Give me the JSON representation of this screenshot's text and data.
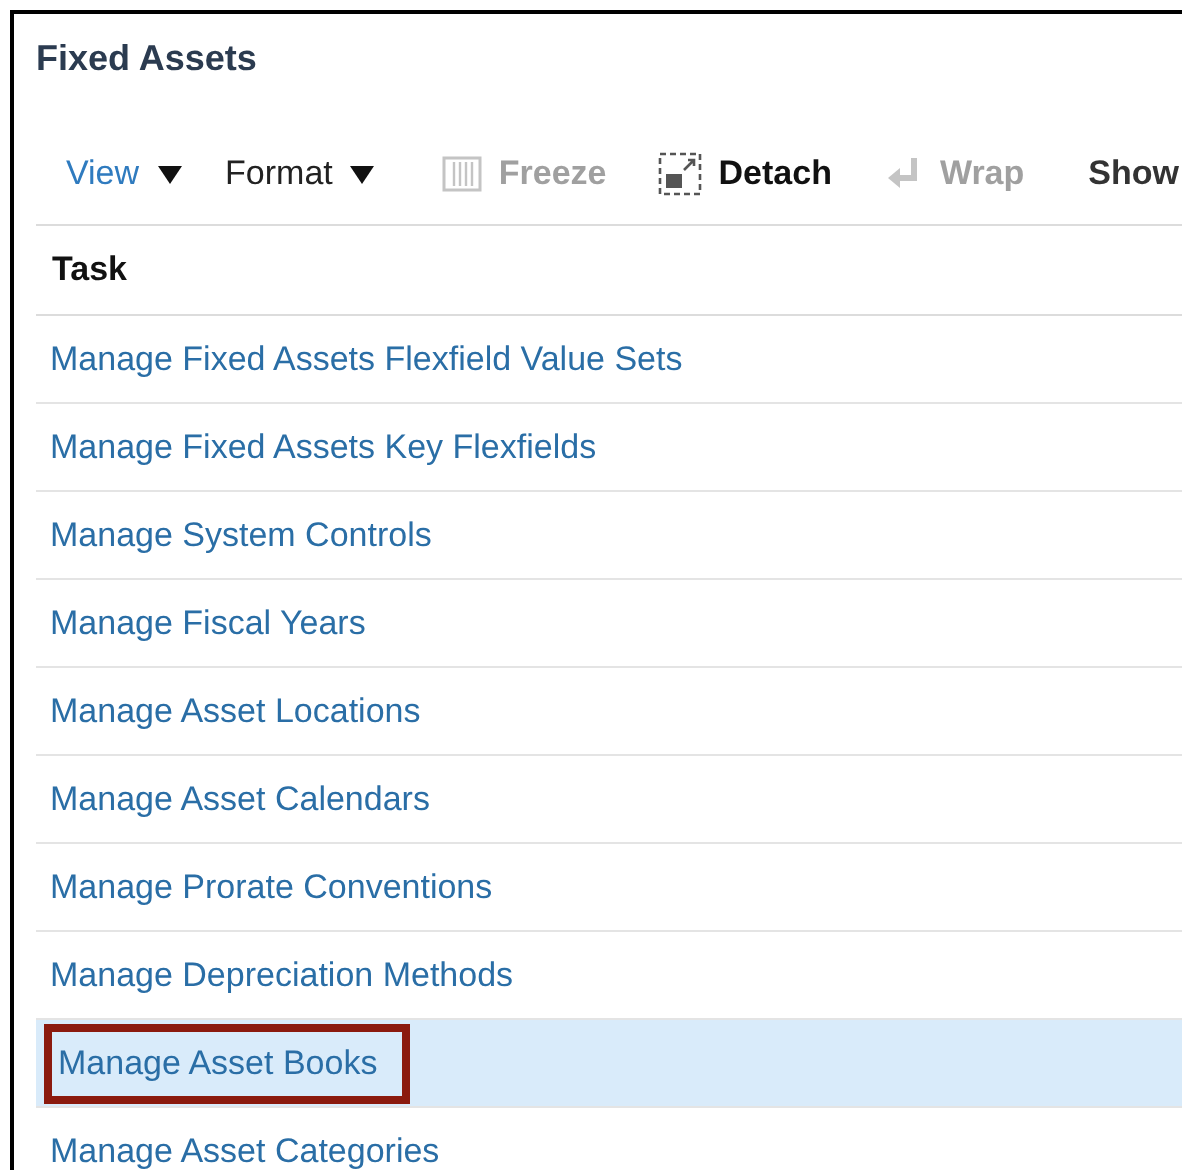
{
  "panel": {
    "title": "Fixed Assets"
  },
  "toolbar": [
    {
      "kind": "menu",
      "label": "View",
      "highlighted": true,
      "disabled": false
    },
    {
      "kind": "menu",
      "label": "Format",
      "highlighted": false,
      "disabled": false
    },
    {
      "kind": "freeze",
      "label": "Freeze",
      "highlighted": false,
      "disabled": true
    },
    {
      "kind": "detach",
      "label": "Detach",
      "highlighted": false,
      "disabled": false
    },
    {
      "kind": "wrap",
      "label": "Wrap",
      "highlighted": false,
      "disabled": true
    },
    {
      "kind": "text",
      "label": "Show",
      "highlighted": false,
      "disabled": false
    }
  ],
  "table": {
    "columns": [
      "Task"
    ],
    "rows": [
      {
        "task": "Manage Fixed Assets Flexfield Value Sets",
        "selected": false,
        "callout": false
      },
      {
        "task": "Manage Fixed Assets Key Flexfields",
        "selected": false,
        "callout": false
      },
      {
        "task": "Manage System Controls",
        "selected": false,
        "callout": false
      },
      {
        "task": "Manage Fiscal Years",
        "selected": false,
        "callout": false
      },
      {
        "task": "Manage Asset Locations",
        "selected": false,
        "callout": false
      },
      {
        "task": "Manage Asset Calendars",
        "selected": false,
        "callout": false
      },
      {
        "task": "Manage Prorate Conventions",
        "selected": false,
        "callout": false
      },
      {
        "task": "Manage Depreciation Methods",
        "selected": false,
        "callout": false
      },
      {
        "task": "Manage Asset Books",
        "selected": true,
        "callout": true
      },
      {
        "task": "Manage Asset Categories",
        "selected": false,
        "callout": false
      }
    ]
  }
}
